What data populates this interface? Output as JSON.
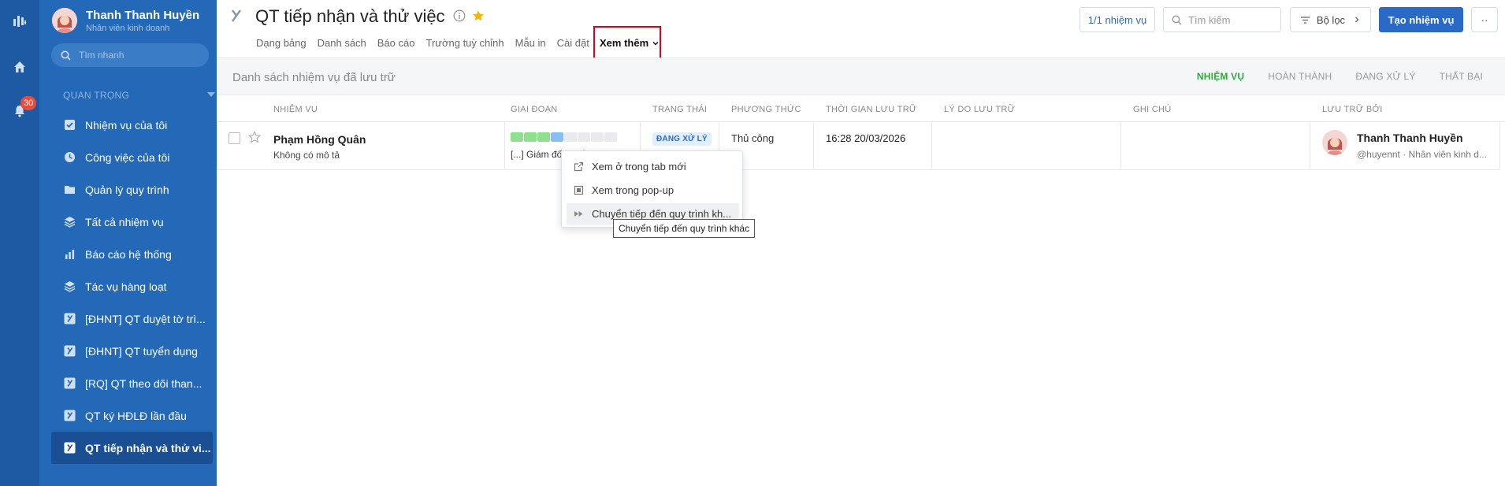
{
  "user": {
    "name": "Thanh Thanh Huyền",
    "role": "Nhân viên kinh doanh"
  },
  "rail": {
    "notification_count": "30"
  },
  "sidebar": {
    "search_placeholder": "Tìm nhanh",
    "section_title": "QUAN TRỌNG",
    "items": [
      {
        "label": "Nhiệm vụ của tôi",
        "icon": "checkbox-icon"
      },
      {
        "label": "Công việc của tôi",
        "icon": "clock-icon"
      },
      {
        "label": "Quản lý quy trình",
        "icon": "folder-icon"
      },
      {
        "label": "Tất cả nhiệm vụ",
        "icon": "layers-icon"
      },
      {
        "label": "Báo cáo hệ thống",
        "icon": "bar-chart-icon"
      },
      {
        "label": "Tác vụ hàng loạt",
        "icon": "layers-icon"
      },
      {
        "label": "[ĐHNT] QT duyệt tờ trì...",
        "icon": "workflow-icon"
      },
      {
        "label": "[ĐHNT] QT tuyển dụng",
        "icon": "workflow-icon"
      },
      {
        "label": "[RQ] QT theo dõi than...",
        "icon": "workflow-icon"
      },
      {
        "label": "QT ký HĐLĐ lần đầu",
        "icon": "workflow-icon"
      },
      {
        "label": "QT tiếp nhận và thử vi...",
        "icon": "workflow-icon"
      }
    ]
  },
  "header": {
    "title": "QT tiếp nhận và thử việc",
    "tabs": [
      "Dạng bảng",
      "Danh sách",
      "Báo cáo",
      "Trường tuỳ chỉnh",
      "Mẫu in",
      "Cài đặt"
    ],
    "more_tab": "Xem thêm",
    "task_count": "1/1 nhiệm vụ",
    "search_placeholder": "Tìm kiếm",
    "filter_label": "Bộ lọc",
    "create_label": "Tạo nhiệm vụ",
    "more_label": "··"
  },
  "subbar": {
    "title": "Danh sách nhiệm vụ đã lưu trữ",
    "filters": [
      "NHIỆM VỤ",
      "HOÀN THÀNH",
      "ĐANG XỬ LÝ",
      "THẤT BẠI"
    ]
  },
  "table": {
    "headers": [
      "NHIỆM VỤ",
      "GIAI ĐOẠN",
      "TRẠNG THÁI",
      "PHƯƠNG THỨC",
      "THỜI GIAN LƯU TRỮ",
      "LÝ DO LƯU TRỮ",
      "GHI CHÚ",
      "LƯU TRỮ BỞI"
    ],
    "rows": [
      {
        "name": "Phạm Hồng Quân",
        "desc": "Không có mô tả",
        "stage_text": "[...] Giám đốc khối đánh ...",
        "stage_segments": [
          "done",
          "done",
          "done",
          "current",
          "todo",
          "todo",
          "todo",
          "todo"
        ],
        "status": "ĐANG XỬ LÝ",
        "method": "Thủ công",
        "archived_at": "16:28 20/03/2026",
        "archived_by": "Thanh Thanh Huyền",
        "archived_by_sub": "@huyennt · Nhân viên kinh d..."
      }
    ]
  },
  "context_menu": {
    "items": [
      {
        "label": "Xem ở trong tab mới",
        "icon": "external-link-icon"
      },
      {
        "label": "Xem trong pop-up",
        "icon": "popup-icon"
      },
      {
        "label": "Chuyển tiếp đến quy trình kh...",
        "icon": "fast-forward-icon"
      }
    ],
    "tooltip": "Chuyển tiếp đến quy trình khác"
  },
  "colors": {
    "sidebar": "#2468b8",
    "rail": "#1e5aa3",
    "accent": "#2a6ac6",
    "stage_done": "#8ee08e",
    "stage_current": "#86bff0",
    "stage_todo": "#e8eaed",
    "active_filter": "#2faa3a"
  }
}
